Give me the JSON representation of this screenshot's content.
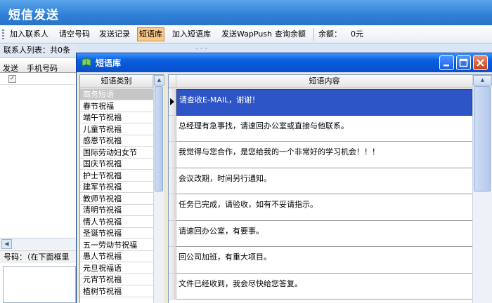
{
  "window": {
    "title": "短信发送"
  },
  "toolbar": {
    "items": [
      "加入联系人",
      "请空号码",
      "发送记录",
      "短语库",
      "加入短语库",
      "发送WapPush",
      "查询余额"
    ],
    "balance_label": "余额：",
    "balance_value": "0元"
  },
  "contacts": {
    "list_label": "联系人列表：共0条",
    "col_send": "发送",
    "col_phone": "手机号码",
    "number_hint": "号码：（在下面框里"
  },
  "dialog": {
    "title": "短语库",
    "category_header": "短语类别",
    "categories": [
      "商务短语",
      "春节祝福",
      "端午节祝福",
      "儿童节祝福",
      "感恩节祝福",
      "国际劳动妇女节",
      "国庆节祝福",
      "护士节祝福",
      "建军节祝福",
      "教师节祝福",
      "清明节祝福",
      "情人节祝福",
      "圣诞节祝福",
      "五一劳动节祝福",
      "愚人节祝福",
      "元旦祝福语",
      "元宵节祝福",
      "植树节祝福"
    ],
    "selected_category": "商务短语",
    "content_header": "短语内容",
    "phrases": [
      "请查收E-MAIL，谢谢！",
      "总经理有急事找，请速回办公室或直接与他联系。",
      "我觉得与您合作，是您给我的一个非常好的学习机会！！！",
      "会议改期，时间另行通知。",
      "任务已完成，请验收，如有不妥请指示。",
      "请速回办公室，有要事。",
      "回公司加班，有重大项目。",
      "文件已经收到，我会尽快给您答复。"
    ]
  },
  "colors": {
    "title_blue": "#2f7fd6",
    "dialog_title_blue": "#0756d6",
    "selection_blue": "#2e55c8",
    "active_tool": "#f7c98a"
  }
}
